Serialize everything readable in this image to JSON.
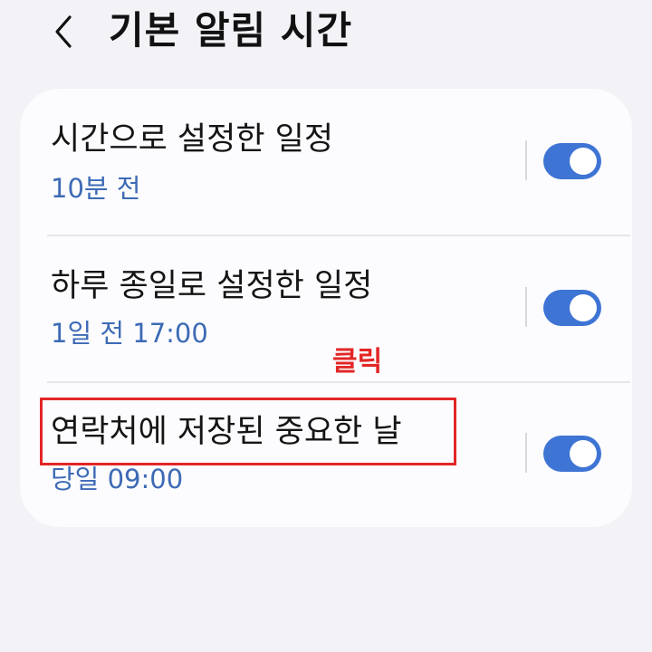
{
  "header": {
    "title": "기본 알림 시간"
  },
  "settings": {
    "items": [
      {
        "title": "시간으로 설정한 일정",
        "subtitle": "10분 전",
        "enabled": true
      },
      {
        "title": "하루 종일로 설정한 일정",
        "subtitle": "1일 전 17:00",
        "enabled": true
      },
      {
        "title": "연락처에 저장된 중요한 날",
        "subtitle": "당일 09:00",
        "enabled": true
      }
    ]
  },
  "annotation": {
    "text": "클릭"
  },
  "colors": {
    "background": "#f2f2f7",
    "card": "#fcfcfe",
    "accent": "#3e74d4",
    "subtitle": "#3d6ab5",
    "highlight": "#e32626"
  }
}
